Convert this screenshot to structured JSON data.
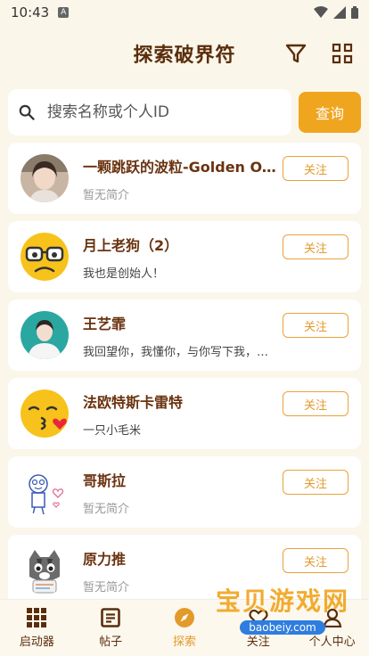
{
  "status": {
    "time": "10:43",
    "notif_letter": "A"
  },
  "header": {
    "title": "探索破界符"
  },
  "search": {
    "placeholder": "搜索名称或个人ID",
    "value": "",
    "button_label": "查询"
  },
  "users": [
    {
      "name": "一颗跳跃的波粒-Golden O...",
      "bio": "暂无简介",
      "bio_muted": true,
      "follow_label": "关注",
      "avatar": "photo-girl"
    },
    {
      "name": "月上老狗（2）",
      "bio": "我也是创始人！",
      "bio_muted": false,
      "follow_label": "关注",
      "avatar": "nerd-emoji"
    },
    {
      "name": "王艺霏",
      "bio": "我回望你，我懂你，与你写下我，你将会替我…",
      "bio_muted": false,
      "follow_label": "关注",
      "avatar": "photo-woman"
    },
    {
      "name": "法欧特斯卡雷特",
      "bio": "一只小毛米",
      "bio_muted": false,
      "follow_label": "关注",
      "avatar": "kiss-emoji"
    },
    {
      "name": "哥斯拉",
      "bio": "暂无简介",
      "bio_muted": true,
      "follow_label": "关注",
      "avatar": "doodle"
    },
    {
      "name": "原力推",
      "bio": "暂无简介",
      "bio_muted": true,
      "follow_label": "关注",
      "avatar": "cat"
    }
  ],
  "nav": [
    {
      "label": "启动器",
      "icon": "grid-icon"
    },
    {
      "label": "帖子",
      "icon": "post-icon"
    },
    {
      "label": "探索",
      "icon": "compass-icon",
      "active": true
    },
    {
      "label": "关注",
      "icon": "heart-icon"
    },
    {
      "label": "个人中心",
      "icon": "person-icon"
    }
  ],
  "watermark": {
    "title": "宝贝游戏网",
    "url": "baobeiy.com"
  },
  "colors": {
    "accent": "#f0a51f",
    "title": "#5a2e0c",
    "background": "#fbf6ea"
  }
}
